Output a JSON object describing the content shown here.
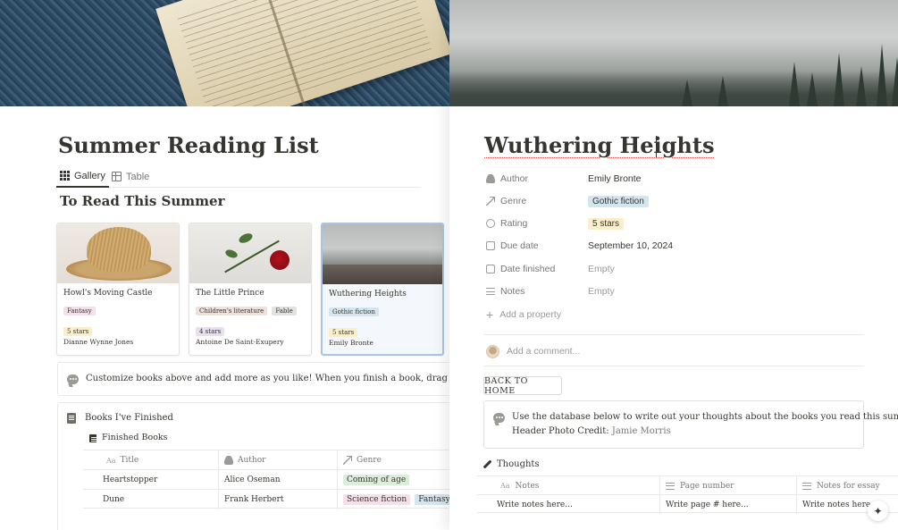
{
  "left": {
    "page_title": "Summer Reading List",
    "tabs": [
      {
        "label": "Gallery",
        "icon": "grid-icon",
        "active": true
      },
      {
        "label": "Table",
        "icon": "table-icon",
        "active": false
      }
    ],
    "section_heading": "To Read This Summer",
    "cards": [
      {
        "title": "Howl's Moving Castle",
        "tags": [
          {
            "label": "Fantasy",
            "color": "#f4dfeb"
          }
        ],
        "rating": "5 stars",
        "author": "Dianne Wynne Jones"
      },
      {
        "title": "The Little Prince",
        "tags": [
          {
            "label": "Children's literature",
            "color": "#eee0da"
          },
          {
            "label": "Fable",
            "color": "#e3e2e0"
          }
        ],
        "rating": "4 stars",
        "author": "Antoine De Saint-Exupery"
      },
      {
        "title": "Wuthering Heights",
        "tags": [
          {
            "label": "Gothic fiction",
            "color": "#d3e5ef"
          }
        ],
        "rating": "5 stars",
        "author": "Emily Bronte"
      }
    ],
    "callout_text": "Customize books above and add more as you like! When you finish a book, drag or move it into t",
    "finished": {
      "title": "Books I've Finished",
      "database": "Finished Books",
      "columns": [
        "Title",
        "Author",
        "Genre"
      ],
      "rows": [
        {
          "title": "Heartstopper",
          "author": "Alice Oseman",
          "genres": [
            {
              "label": "Coming of age",
              "color": "#dbeddb"
            }
          ]
        },
        {
          "title": "Dune",
          "author": "Frank Herbert",
          "genres": [
            {
              "label": "Science fiction",
              "color": "#f4dfeb"
            },
            {
              "label": "Fantasy",
              "color": "#d3e5ef"
            }
          ]
        }
      ]
    }
  },
  "right": {
    "title": "Wuthering Heights",
    "properties": [
      {
        "name": "Author",
        "icon": "person-icon",
        "value": "Emily Bronte",
        "type": "text"
      },
      {
        "name": "Genre",
        "icon": "arrow-icon",
        "value": "Gothic fiction",
        "type": "tag",
        "color": "#d3e5ef"
      },
      {
        "name": "Rating",
        "icon": "circle-icon",
        "value": "5 stars",
        "type": "tag",
        "color": "#fbeecb"
      },
      {
        "name": "Due date",
        "icon": "calendar-icon",
        "value": "September 10, 2024",
        "type": "text"
      },
      {
        "name": "Date finished",
        "icon": "calendar-icon",
        "value": "Empty",
        "type": "empty"
      },
      {
        "name": "Notes",
        "icon": "lines-icon",
        "value": "Empty",
        "type": "empty"
      }
    ],
    "add_property": "Add a property",
    "comment_placeholder": "Add a comment...",
    "back_button": "BACK TO HOME",
    "callout_line1": "Use the database below to write out your thoughts about the books you read this summer.",
    "callout_line2_prefix": "Header Photo Credit:",
    "callout_line2_credit": "Jamie Morris",
    "thoughts": {
      "title": "Thoughts",
      "columns": [
        "Notes",
        "Page number",
        "Notes for essay"
      ],
      "row": [
        "Write notes here...",
        "Write page # here...",
        "Write notes here..."
      ]
    },
    "help_icon": "sparkle-icon"
  }
}
